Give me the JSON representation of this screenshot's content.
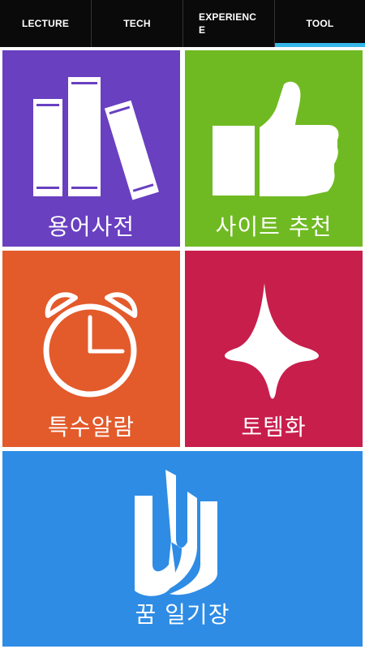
{
  "tabs": [
    {
      "label": "LECTURE",
      "active": false
    },
    {
      "label": "TECH",
      "active": false
    },
    {
      "label": "EXPERIENCE",
      "active": false
    },
    {
      "label": "TOOL",
      "active": true
    }
  ],
  "tiles": {
    "dictionary": {
      "label": "용어사전",
      "color": "#6840c0",
      "icon": "books-icon"
    },
    "site_recommend": {
      "label": "사이트 추천",
      "color": "#6fba22",
      "icon": "thumbs-up-icon"
    },
    "alarm": {
      "label": "특수알람",
      "color": "#e35a2b",
      "icon": "alarm-clock-icon"
    },
    "totem": {
      "label": "토템화",
      "color": "#c81e4c",
      "icon": "spinning-top-icon"
    },
    "dream_diary": {
      "label": "꿈 일기장",
      "color": "#2e8ce5",
      "icon": "open-book-icon"
    }
  },
  "colors": {
    "tab_bar_bg": "#0a0a0a",
    "tab_indicator": "#35b7e8"
  }
}
